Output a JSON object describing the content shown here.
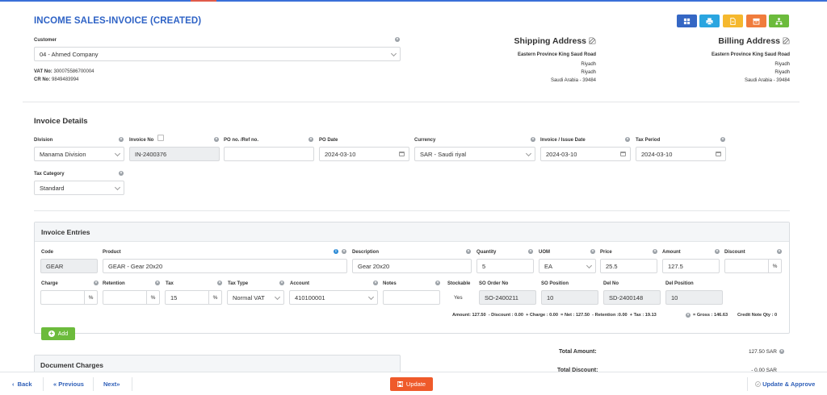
{
  "page": {
    "title": "INCOME SALES-INVOICE (CREATED)"
  },
  "toolbar": {
    "buttons": [
      {
        "icon": "grid-icon",
        "color": "#3567c4"
      },
      {
        "icon": "print-icon",
        "color": "#2aa5e0"
      },
      {
        "icon": "pdf-icon",
        "color": "#f5b82e"
      },
      {
        "icon": "archive-icon",
        "color": "#f07c3c"
      },
      {
        "icon": "sitemap-icon",
        "color": "#6cbb3c"
      }
    ]
  },
  "customer": {
    "label": "Customer",
    "value": "04 - Ahmed Company",
    "vat_label": "VAT No:",
    "vat_value": "300075586700004",
    "cr_label": "CR No:",
    "cr_value": "9849483994"
  },
  "shipping": {
    "title": "Shipping Address",
    "line1": "Eastern Province King Saud Road",
    "line2": "Riyadh",
    "line3": "Riyadh",
    "line4": "Saudi Arabia - 39484"
  },
  "billing": {
    "title": "Billing Address",
    "line1": "Eastern Province King Saud Road",
    "line2": "Riyadh",
    "line3": "Riyadh",
    "line4": "Saudi Arabia - 39484"
  },
  "details": {
    "title": "Invoice Details",
    "division": {
      "label": "Division",
      "value": "Manama Division"
    },
    "invoice_no": {
      "label": "Invoice No",
      "value": "IN-2400376"
    },
    "po_ref": {
      "label": "PO no. /Ref no.",
      "value": ""
    },
    "po_date": {
      "label": "PO Date",
      "value": "2024-03-10"
    },
    "currency": {
      "label": "Currency",
      "value": "SAR - Saudi riyal"
    },
    "issue_date": {
      "label": "Invoice / Issue Date",
      "value": "2024-03-10"
    },
    "tax_period": {
      "label": "Tax Period",
      "value": "2024-03-10"
    },
    "tax_category": {
      "label": "Tax Category",
      "value": "Standard"
    }
  },
  "entries": {
    "title": "Invoice Entries",
    "code": {
      "label": "Code",
      "value": "GEAR"
    },
    "product": {
      "label": "Product",
      "value": "GEAR - Gear 20x20"
    },
    "description": {
      "label": "Description",
      "value": "Gear 20x20"
    },
    "quantity": {
      "label": "Quantity",
      "value": "5"
    },
    "uom": {
      "label": "UOM",
      "value": "EA"
    },
    "price": {
      "label": "Price",
      "value": "25.5"
    },
    "amount": {
      "label": "Amount",
      "value": "127.5"
    },
    "discount": {
      "label": "Discount",
      "value": "",
      "suffix": "%"
    },
    "charge": {
      "label": "Charge",
      "value": "",
      "suffix": "%"
    },
    "retention": {
      "label": "Retention",
      "value": "",
      "suffix": "%"
    },
    "tax": {
      "label": "Tax",
      "value": "15",
      "suffix": "%"
    },
    "tax_type": {
      "label": "Tax Type",
      "value": "Normal VAT"
    },
    "account": {
      "label": "Account",
      "value": "410100001"
    },
    "notes": {
      "label": "Notes",
      "value": ""
    },
    "stockable": {
      "label": "Stockable",
      "value": "Yes"
    },
    "so_order": {
      "label": "SO Order No",
      "value": "SO-2400211"
    },
    "so_position": {
      "label": "SO Position",
      "value": "10"
    },
    "del_no": {
      "label": "Del No",
      "value": "SD-2400148"
    },
    "del_position": {
      "label": "Del Position",
      "value": "10"
    },
    "summary": "Amount: 127.50  - Discount : 0.00  + Charge : 0.00  = Net : 127.50  - Retention :0.00  + Tax : 19.13",
    "gross": "= Gross : 146.63",
    "credit_note": "Credit Note Qty : 0",
    "add_label": "Add"
  },
  "charges": {
    "title": "Document Charges"
  },
  "totals": {
    "total_amount_label": "Total Amount:",
    "total_amount_value": "127.50 SAR",
    "total_discount_label": "Total Discount:",
    "total_discount_value": "- 0.00 SAR"
  },
  "footer": {
    "back": "Back",
    "previous": "Previous",
    "next": "Next",
    "update": "Update",
    "update_approve": "Update & Approve"
  }
}
